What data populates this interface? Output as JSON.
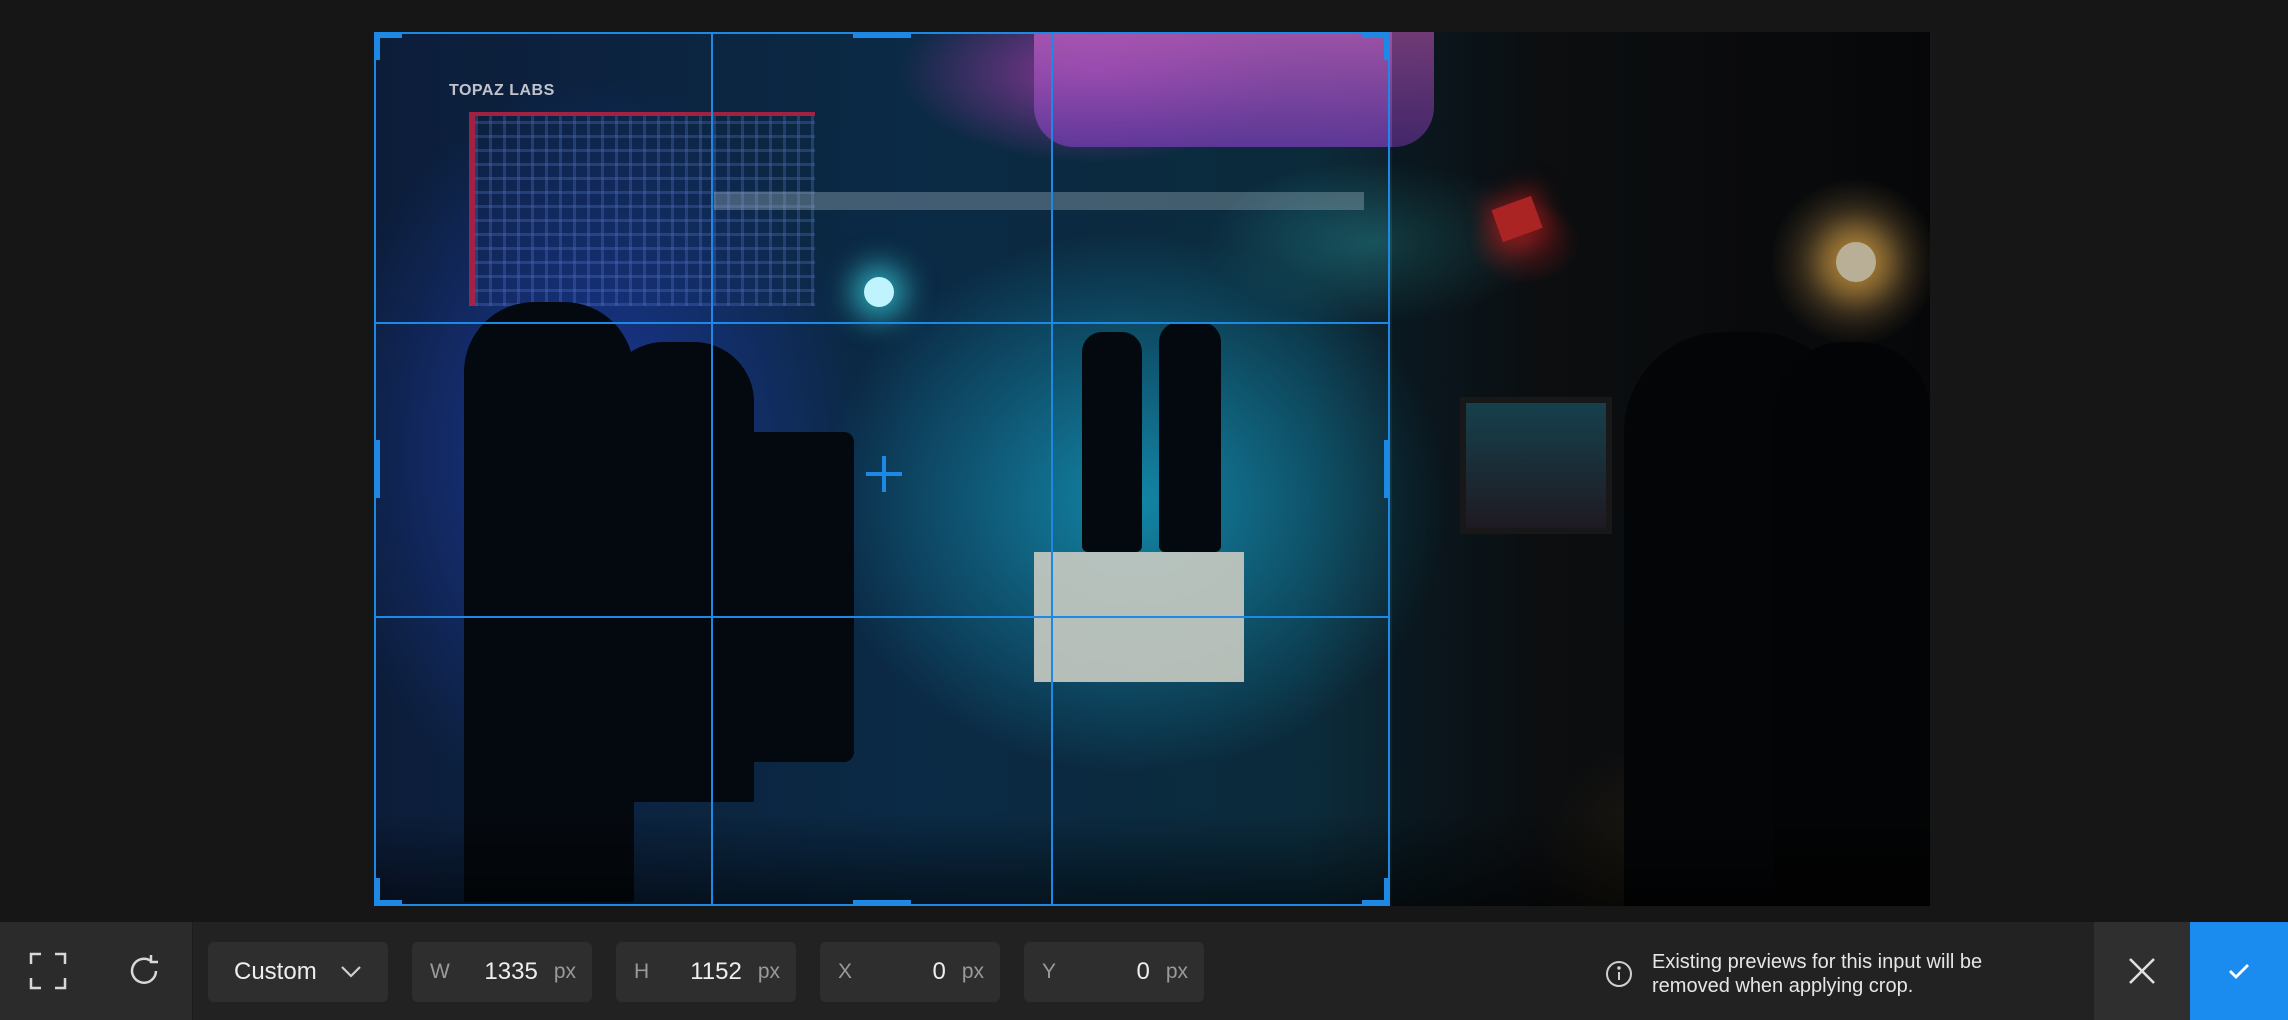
{
  "photo": {
    "watermark": "TOPAZ LABS"
  },
  "toolbar": {
    "fit_icon": "fit-to-screen-icon",
    "rotate_icon": "rotate-icon",
    "ratio": {
      "selected": "Custom"
    },
    "width": {
      "label": "W",
      "value": "1335",
      "unit": "px"
    },
    "height": {
      "label": "H",
      "value": "1152",
      "unit": "px"
    },
    "x": {
      "label": "X",
      "value": "0",
      "unit": "px"
    },
    "y": {
      "label": "Y",
      "value": "0",
      "unit": "px"
    },
    "notice": "Existing previews for this input will be removed when applying crop.",
    "cancel_icon": "close-icon",
    "apply_icon": "checkmark-icon"
  },
  "colors": {
    "accent": "#1e88e5",
    "apply_button": "#1a8cf0",
    "toolbar_bg": "#222222"
  }
}
